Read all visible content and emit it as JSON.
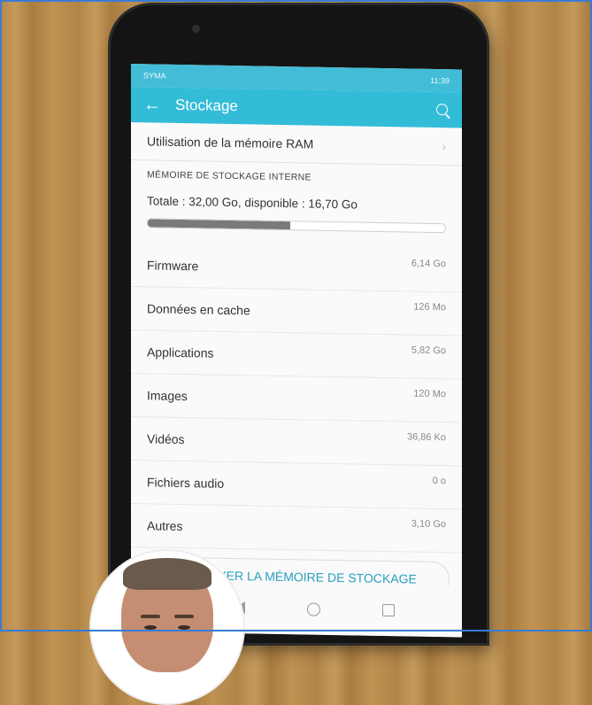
{
  "status_bar": {
    "carrier": "SYMA",
    "time": "11:39"
  },
  "app_bar": {
    "title": "Stockage",
    "back_icon": "arrow-left-icon",
    "search_icon": "search-icon"
  },
  "ram_row": {
    "label": "Utilisation de la mémoire RAM",
    "chevron_icon": "chevron-right-icon"
  },
  "internal_storage": {
    "section_title": "MÉMOIRE DE STOCKAGE INTERNE",
    "totals": "Totale : 32,00  Go, disponible : 16,70  Go",
    "used_fraction": 0.48,
    "items": [
      {
        "label": "Firmware",
        "value": "6,14  Go"
      },
      {
        "label": "Données en cache",
        "value": "126  Mo"
      },
      {
        "label": "Applications",
        "value": "5,82  Go"
      },
      {
        "label": "Images",
        "value": "120  Mo"
      },
      {
        "label": "Vidéos",
        "value": "36,86  Ko"
      },
      {
        "label": "Fichiers audio",
        "value": "0  o"
      },
      {
        "label": "Autres",
        "value": "3,10  Go"
      }
    ]
  },
  "clean_button": {
    "label": "NETTOYER LA MÉMOIRE DE STOCKAGE"
  },
  "nav_bar": {
    "icons": [
      "back-triangle-icon",
      "home-circle-icon",
      "recent-square-icon"
    ]
  },
  "colors": {
    "app_bar": "#33bcd7",
    "accent_text": "#2a9fc0",
    "storage_fill": "#7a7a7a"
  }
}
